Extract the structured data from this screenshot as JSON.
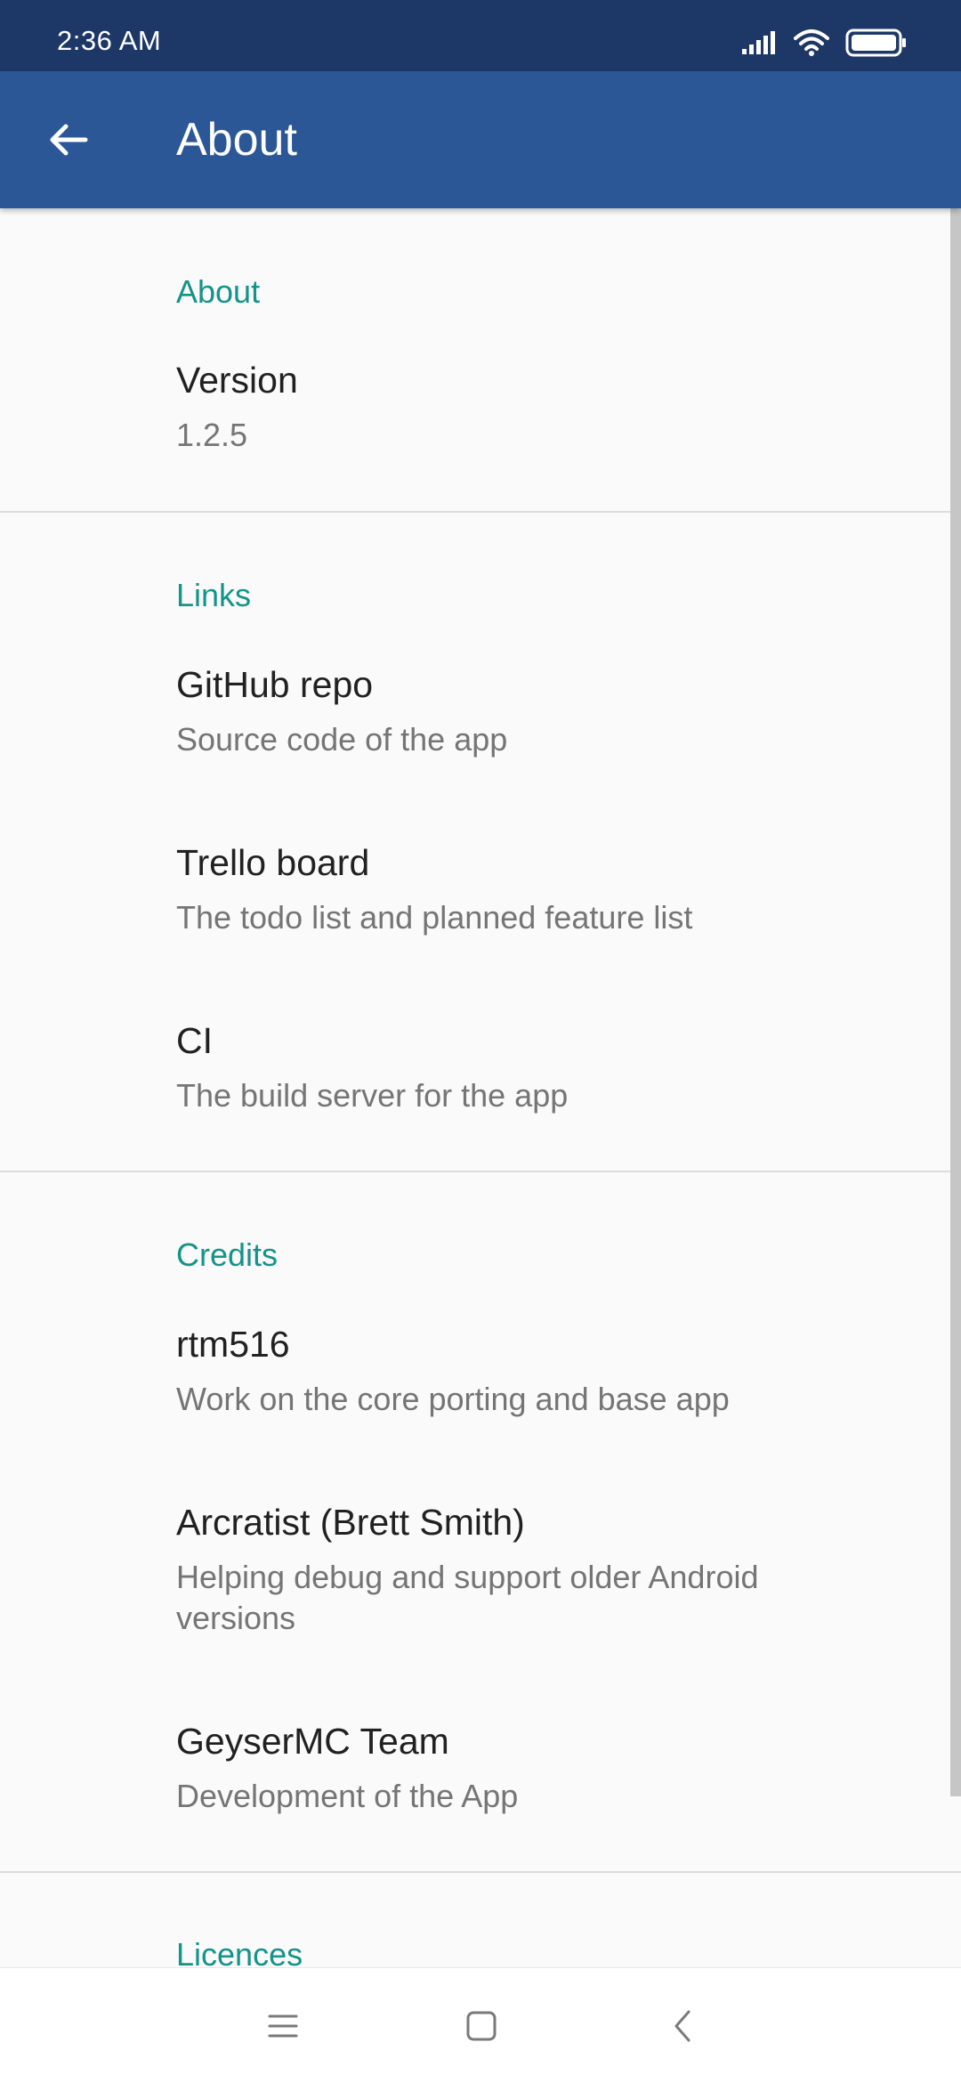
{
  "status_bar": {
    "time": "2:36 AM",
    "icons": [
      "signal-icon",
      "wifi-icon",
      "battery-icon"
    ]
  },
  "app_bar": {
    "title": "About",
    "back_icon": "arrow-back-icon"
  },
  "sections": {
    "about": {
      "header": "About",
      "items": [
        {
          "title": "Version",
          "summary": "1.2.5"
        }
      ]
    },
    "links": {
      "header": "Links",
      "items": [
        {
          "title": "GitHub repo",
          "summary": "Source code of the app"
        },
        {
          "title": "Trello board",
          "summary": "The todo list and planned feature list"
        },
        {
          "title": "CI",
          "summary": "The build server for the app"
        }
      ]
    },
    "credits": {
      "header": "Credits",
      "items": [
        {
          "title": "rtm516",
          "summary": "Work on the core porting and base app"
        },
        {
          "title": "Arcratist (Brett Smith)",
          "summary": "Helping debug and support older Android versions"
        },
        {
          "title": "GeyserMC Team",
          "summary": "Development of the App"
        }
      ]
    },
    "licences": {
      "header": "Licences"
    }
  },
  "nav_bar": {
    "icons": [
      "menu-icon",
      "home-icon",
      "back-icon"
    ]
  },
  "colors": {
    "status_bar": "#1d3867",
    "app_bar": "#2b5797",
    "accent": "#139488",
    "background": "#fafafa"
  }
}
